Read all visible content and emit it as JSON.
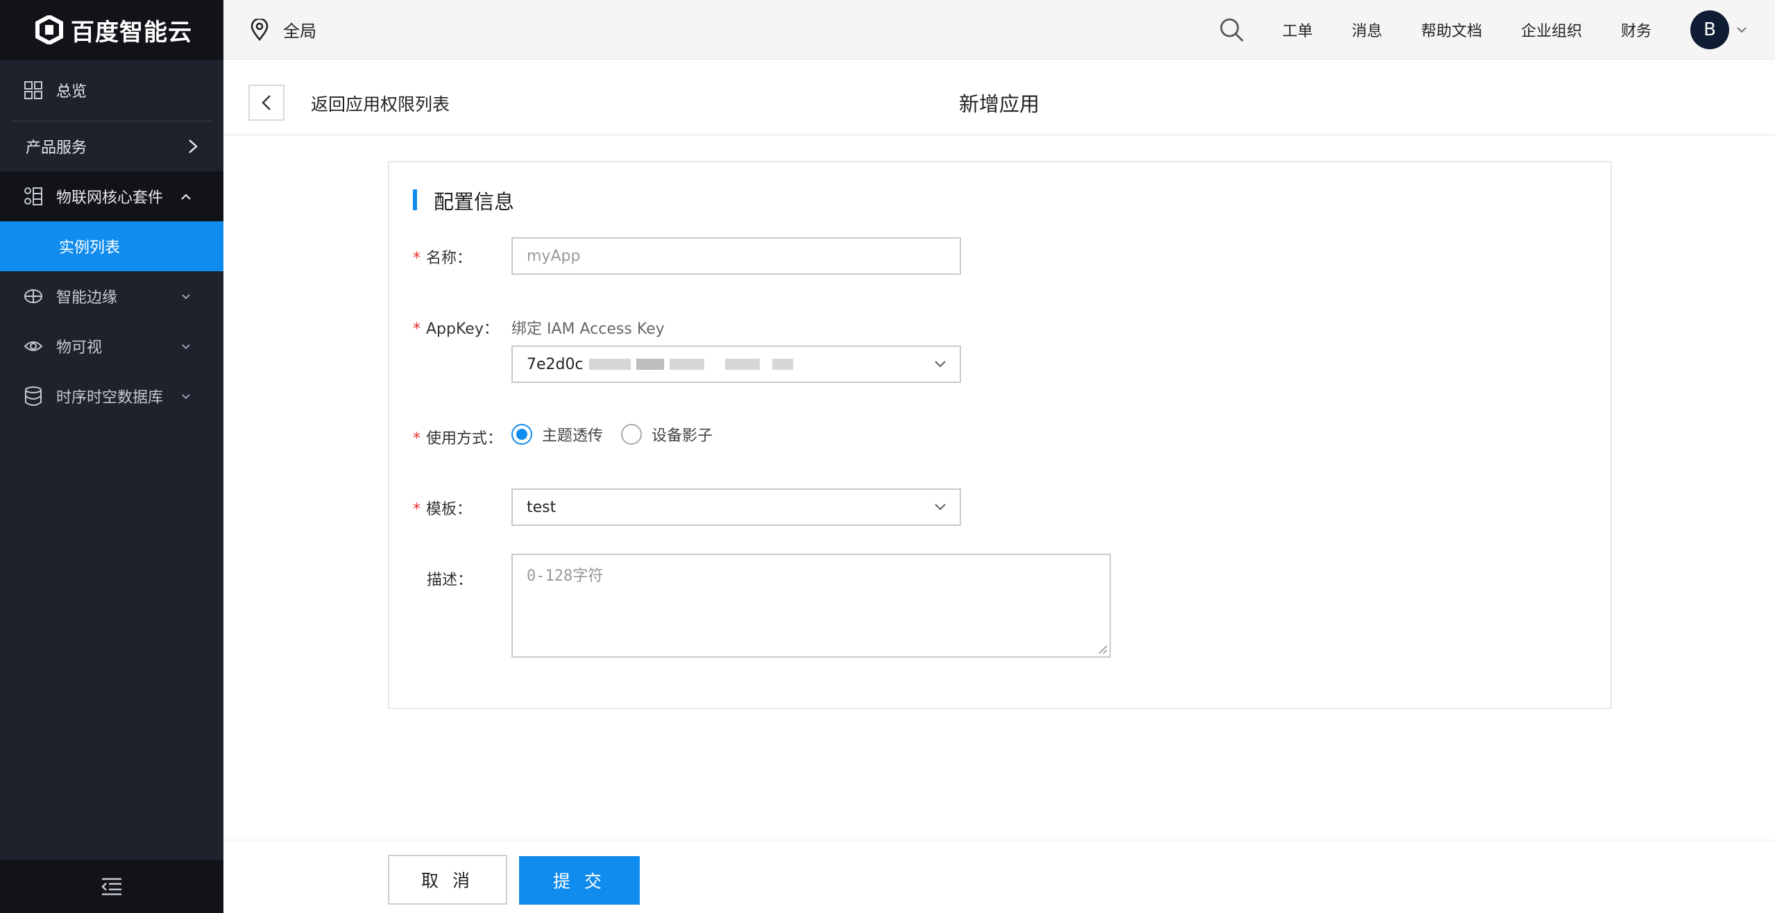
{
  "brand": {
    "logo_text": "百度智能云"
  },
  "sidebar": {
    "overview": "总览",
    "products": "产品服务",
    "iot_core": "物联网核心套件",
    "instance_list": "实例列表",
    "edge": "智能边缘",
    "visual": "物可视",
    "tsdb": "时序时空数据库"
  },
  "header": {
    "region": "全局",
    "links": [
      "工单",
      "消息",
      "帮助文档",
      "企业组织",
      "财务"
    ],
    "avatar_letter": "B"
  },
  "titlebar": {
    "back_label": "返回应用权限列表",
    "title": "新增应用"
  },
  "form": {
    "section_title": "配置信息",
    "name_label": "名称：",
    "name_value": "myApp",
    "appkey_label": "AppKey：",
    "appkey_hint": "绑定 IAM Access Key",
    "appkey_value": "7e2d0c",
    "mode_label": "使用方式：",
    "mode_options": [
      "主题透传",
      "设备影子"
    ],
    "template_label": "模板：",
    "template_value": "test",
    "desc_label": "描述：",
    "desc_placeholder": "0-128字符"
  },
  "footer": {
    "cancel": "取 消",
    "submit": "提 交"
  },
  "colors": {
    "accent": "#108cee",
    "sidebar_bg": "#1e222d",
    "required": "#ea2e2e"
  }
}
